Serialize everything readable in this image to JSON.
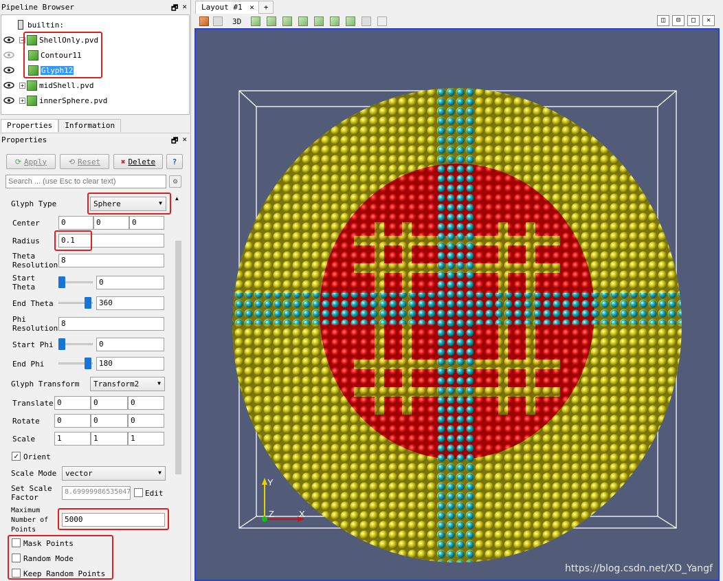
{
  "pipeline": {
    "title": "Pipeline Browser",
    "root": "builtin:",
    "items": [
      {
        "label": "ShellOnly.pvd",
        "expander": "−"
      },
      {
        "label": "Contour11",
        "expander": ""
      },
      {
        "label": "Glyph12",
        "expander": ""
      },
      {
        "label": "midShell.pvd",
        "expander": "+"
      },
      {
        "label": "innerSphere.pvd",
        "expander": "+"
      }
    ]
  },
  "dock_buttons": {
    "float": "🗗",
    "close": "✕"
  },
  "tabs": {
    "properties": "Properties",
    "information": "Information"
  },
  "props": {
    "title": "Properties",
    "apply": "Apply",
    "reset": "Reset",
    "delete": "Delete",
    "help": "?",
    "search_placeholder": "Search ... (use Esc to clear text)",
    "glyph_type_label": "Glyph Type",
    "glyph_type": "Sphere",
    "center_label": "Center",
    "center": [
      "0",
      "0",
      "0"
    ],
    "radius_label": "Radius",
    "radius": "0.1",
    "theta_res_label": "Theta Resolution",
    "theta_res": "8",
    "start_theta_label": "Start Theta",
    "start_theta": "0",
    "end_theta_label": "End Theta",
    "end_theta": "360",
    "phi_res_label": "Phi Resolution",
    "phi_res": "8",
    "start_phi_label": "Start Phi",
    "start_phi": "0",
    "end_phi_label": "End Phi",
    "end_phi": "180",
    "glyph_transform_label": "Glyph Transform",
    "glyph_transform": "Transform2",
    "translate_label": "Translate",
    "translate": [
      "0",
      "0",
      "0"
    ],
    "rotate_label": "Rotate",
    "rotate": [
      "0",
      "0",
      "0"
    ],
    "scale_label": "Scale",
    "scale": [
      "1",
      "1",
      "1"
    ],
    "orient_label": "Orient",
    "orient_check": "✓",
    "scale_mode_label": "Scale Mode",
    "scale_mode": "vector",
    "scale_factor_label": "Set Scale Factor",
    "scale_factor": "8.69999986535047",
    "edit_label": "Edit",
    "max_points_label": "Maximum Number of Points",
    "max_points": "5000",
    "mask_points": "Mask Points",
    "random_mode": "Random Mode",
    "keep_random": "Keep Random Points"
  },
  "layout": {
    "tab": "Layout #1",
    "close": "✕",
    "add": "+",
    "mode_3d": "3D"
  },
  "axes": {
    "x": "X",
    "y": "Y",
    "z": "Z"
  },
  "watermark": "https://blog.csdn.net/XD_Yangf",
  "colors": {
    "yellow": "#d8d01a",
    "cyan": "#21b8c4",
    "red": "#e01010",
    "bg": "#525c78",
    "highlight": "#3399ff",
    "accent_border": "#1f3ff0",
    "callout": "#e02020"
  }
}
